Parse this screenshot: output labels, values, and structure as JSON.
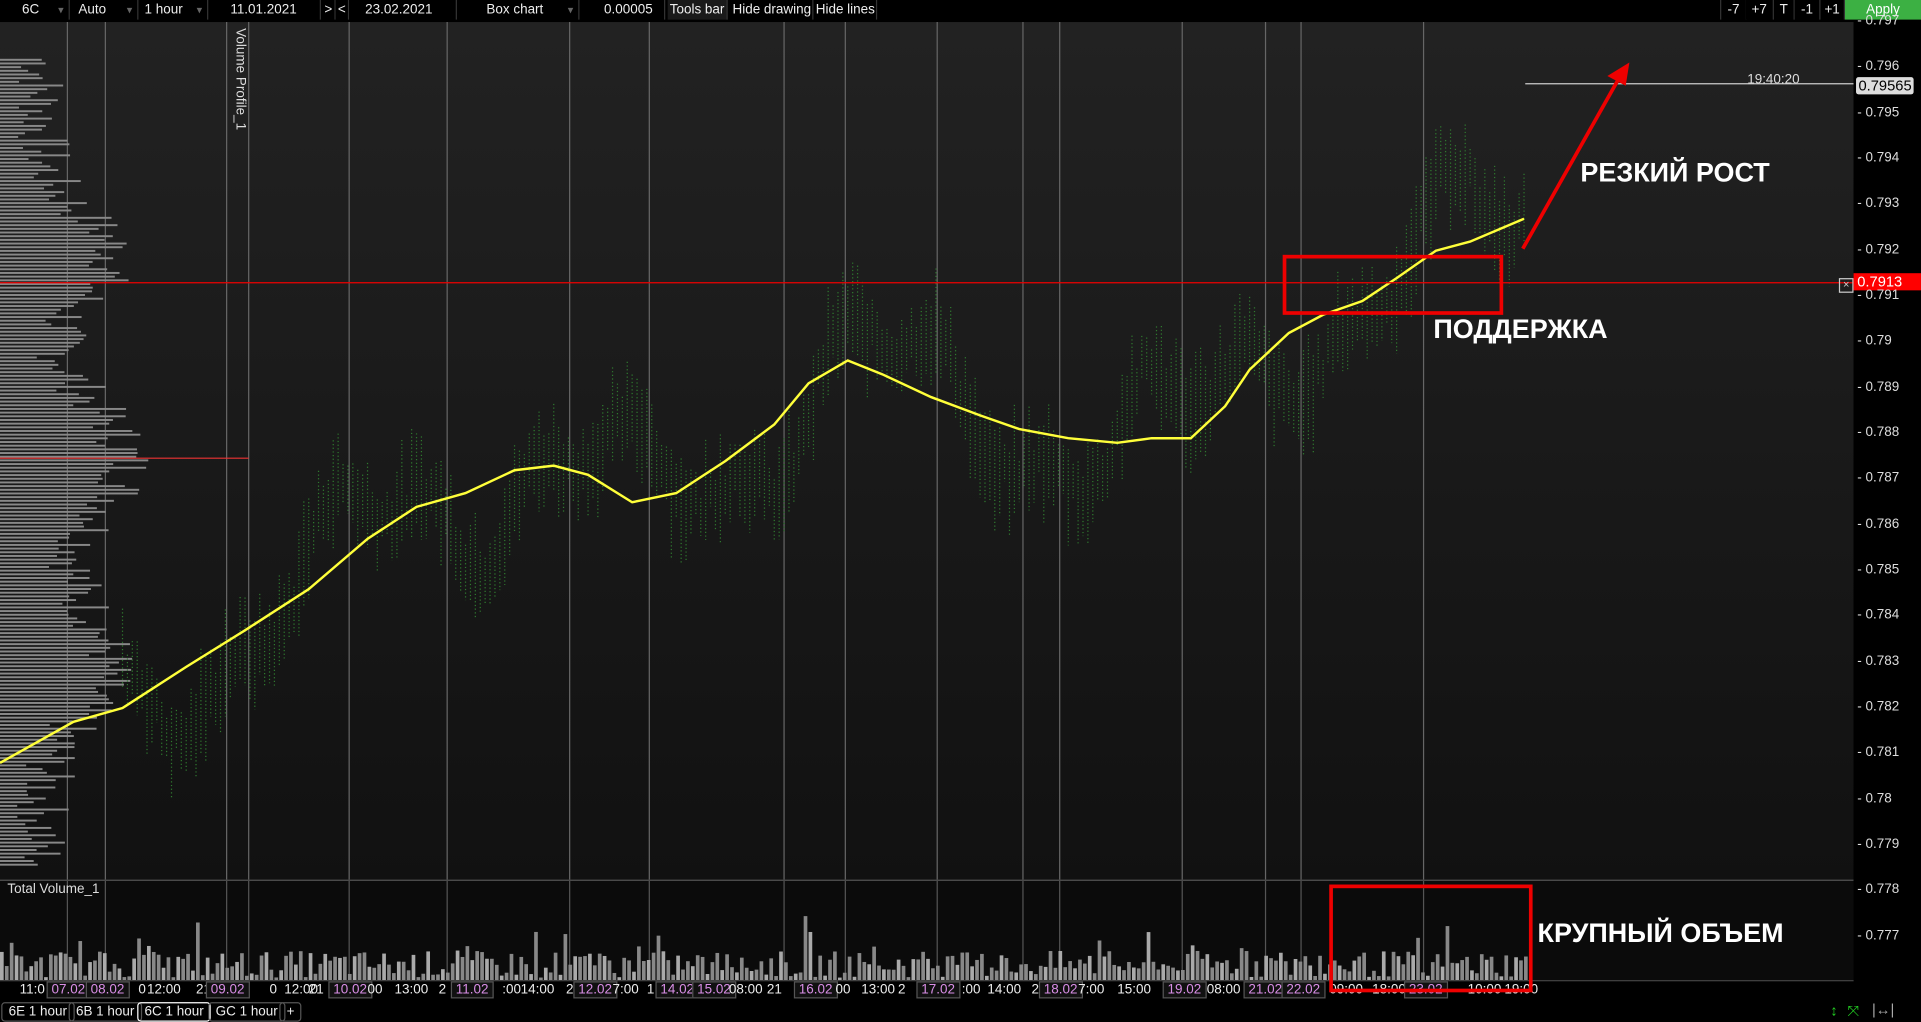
{
  "toolbar": {
    "symbol": "6C",
    "scale": "Auto",
    "timeframe": "1 hour",
    "date_from": "11.01.2021",
    "nav_next": ">",
    "nav_prev": "<",
    "date_to": "23.02.2021",
    "chart_type": "Box chart",
    "tick_size": "0.00005",
    "tools_bar": "Tools bar",
    "hide_drawing": "Hide drawing",
    "hide_lines": "Hide lines",
    "minus7": "-7",
    "plus7": "+7",
    "today": "T",
    "minus1": "-1",
    "plus1": "+1",
    "apply": "Apply",
    "apply_color": "#3cb043"
  },
  "chart": {
    "indicator_label": "Volume Profile_1",
    "volume_label": "Total Volume_1",
    "current_price": "0.79565",
    "current_time": "19:40:20",
    "level_price": "0.7913",
    "level_color": "#ff0000",
    "price_ticks": [
      "0.797",
      "0.796",
      "0.795",
      "0.794",
      "0.793",
      "0.792",
      "0.791",
      "0.79",
      "0.789",
      "0.788",
      "0.787",
      "0.786",
      "0.785",
      "0.784",
      "0.783",
      "0.782",
      "0.781",
      "0.78",
      "0.779",
      "0.778",
      "0.777"
    ],
    "x_labels": [
      "11:0",
      "07.02",
      "08.02",
      "0",
      "12:00",
      "21",
      "09.02",
      "0",
      "12:00",
      "21",
      "10.02",
      "00",
      "13:00",
      "2",
      "11.02",
      ":00",
      "14:00",
      "2",
      "12.02",
      "7:00",
      "1",
      "14.02",
      "15.02",
      "08:00",
      "21",
      "16.02",
      "00",
      "13:00",
      "2",
      "17.02",
      ":00",
      "14:00",
      "2",
      "18.02",
      "7:00",
      "15:00",
      "19.02",
      "08:00",
      "21.02",
      "22.02",
      "09:00",
      "18:00",
      "23.02",
      "10:00",
      "19:00"
    ]
  },
  "annotations": {
    "growth": "РЕЗКИЙ РОСТ",
    "support": "ПОДДЕРЖКА",
    "volume": "КРУПНЫЙ ОБЪЕМ"
  },
  "tabs": [
    "6E 1 hour",
    "6B 1 hour",
    "6C 1 hour",
    "GC 1 hour",
    "+"
  ],
  "chart_data": {
    "type": "line",
    "title": "6C 1 hour",
    "ylim": [
      0.7775,
      0.797
    ],
    "moving_average": {
      "bars": [
        0,
        15,
        25,
        38,
        50,
        63,
        75,
        85,
        95,
        105,
        113,
        120,
        129,
        138,
        148,
        158,
        165,
        173,
        180,
        190,
        200,
        208,
        218,
        228,
        235,
        243,
        250,
        255,
        263,
        270,
        278,
        285,
        293,
        300,
        311
      ],
      "values": [
        0.7808,
        0.7817,
        0.782,
        0.7829,
        0.7837,
        0.7846,
        0.7857,
        0.7864,
        0.7867,
        0.7872,
        0.7873,
        0.7871,
        0.7865,
        0.7867,
        0.7874,
        0.7882,
        0.7891,
        0.7896,
        0.7893,
        0.7888,
        0.7884,
        0.7881,
        0.7879,
        0.7878,
        0.7879,
        0.7879,
        0.7886,
        0.7894,
        0.7902,
        0.7906,
        0.7909,
        0.7914,
        0.792,
        0.7922,
        0.7927
      ]
    }
  }
}
